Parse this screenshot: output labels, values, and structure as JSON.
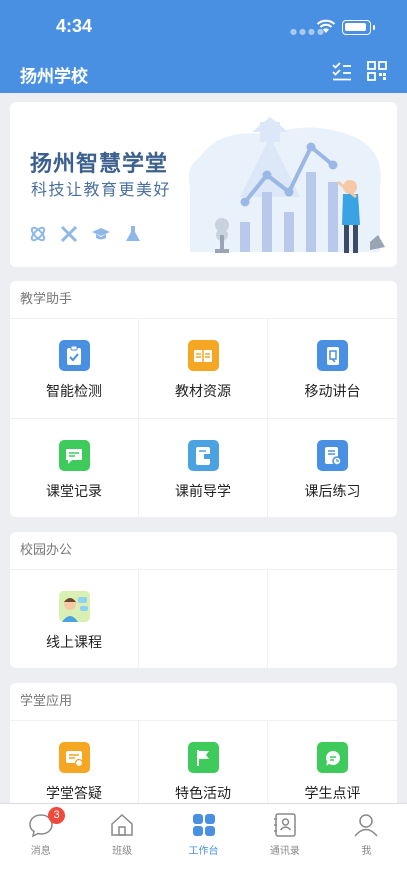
{
  "status": {
    "time": "4:34"
  },
  "header": {
    "title": "扬州学校"
  },
  "banner": {
    "title": "扬州智慧学堂",
    "subtitle": "科技让教育更美好"
  },
  "sections": [
    {
      "title": "教学助手",
      "items": [
        {
          "label": "智能检测",
          "icon": "checklist-icon",
          "color": "#4a90e2"
        },
        {
          "label": "教材资源",
          "icon": "book-icon",
          "color": "#f5a623"
        },
        {
          "label": "移动讲台",
          "icon": "mobile-icon",
          "color": "#4a90e2"
        },
        {
          "label": "课堂记录",
          "icon": "chat-icon",
          "color": "#3fcb5b"
        },
        {
          "label": "课前导学",
          "icon": "guide-book-icon",
          "color": "#4a90e2"
        },
        {
          "label": "课后练习",
          "icon": "exercise-icon",
          "color": "#4a90e2"
        }
      ]
    },
    {
      "title": "校园办公",
      "items": [
        {
          "label": "线上课程",
          "icon": "online-course-icon",
          "color": "#8fd46e"
        }
      ]
    },
    {
      "title": "学堂应用",
      "items": [
        {
          "label": "学堂答疑",
          "icon": "qa-icon",
          "color": "#f5a623"
        },
        {
          "label": "特色活动",
          "icon": "flag-icon",
          "color": "#3fcb5b"
        },
        {
          "label": "学生点评",
          "icon": "comment-icon",
          "color": "#3fcb5b"
        }
      ]
    }
  ],
  "tabbar": {
    "items": [
      {
        "label": "消息",
        "badge": "3"
      },
      {
        "label": "班级"
      },
      {
        "label": "工作台"
      },
      {
        "label": "通讯录"
      },
      {
        "label": "我"
      }
    ]
  },
  "colors": {
    "primary": "#4a90e2",
    "badge": "#ef4a3c"
  }
}
